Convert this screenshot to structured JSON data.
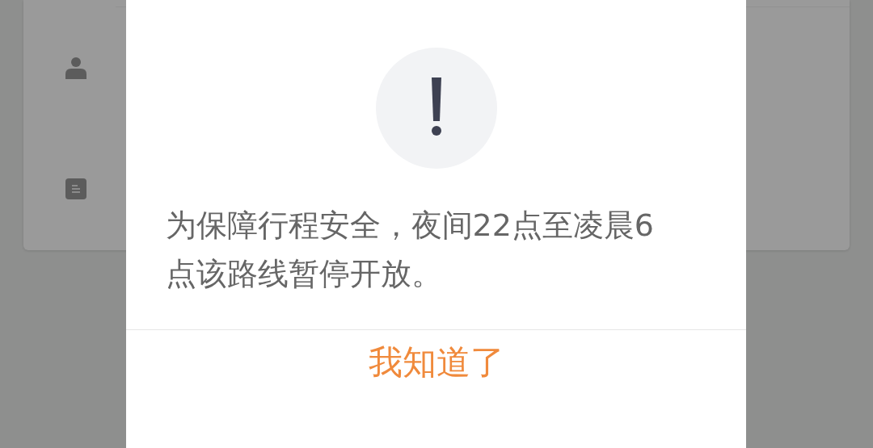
{
  "card": {
    "rows": [
      {
        "kind": "person"
      },
      {
        "kind": "document"
      }
    ]
  },
  "dialog": {
    "message": "为保障行程安全，夜间22点至凌晨6点该路线暂停开放。",
    "button": "我知道了"
  }
}
